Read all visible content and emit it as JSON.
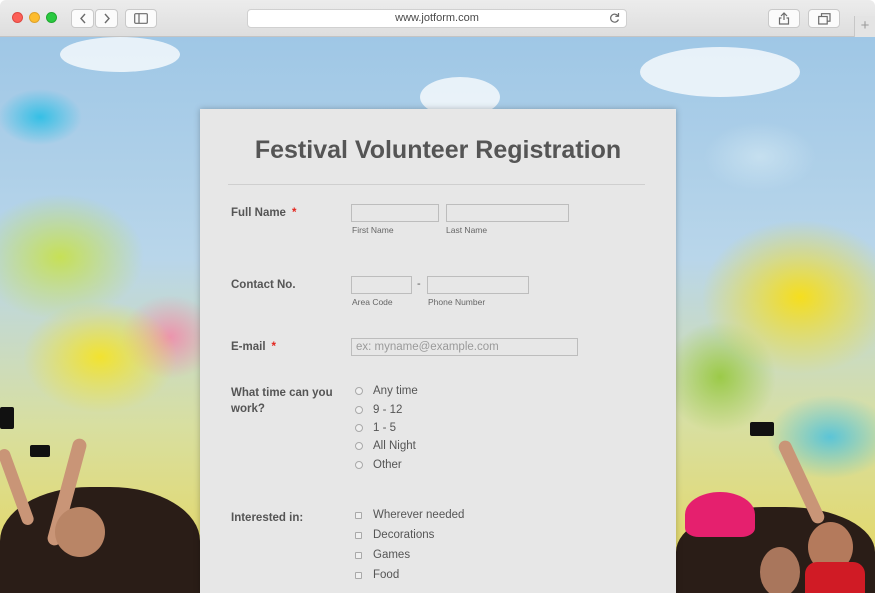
{
  "browser": {
    "url": "www.jotform.com",
    "new_tab": "+"
  },
  "form": {
    "title": "Festival Volunteer Registration",
    "full_name": {
      "label": "Full Name",
      "required_mark": "*",
      "first_value": "",
      "last_value": "",
      "first_sublabel": "First Name",
      "last_sublabel": "Last Name"
    },
    "contact": {
      "label": "Contact No.",
      "separator": "-",
      "area_sublabel": "Area Code",
      "phone_sublabel": "Phone Number"
    },
    "email": {
      "label": "E-mail",
      "required_mark": "*",
      "placeholder": "ex: myname@example.com"
    },
    "time": {
      "label_line1": "What time can you",
      "label_line2": "work?",
      "options": [
        "Any time",
        "9 - 12",
        "1 - 5",
        "All Night",
        "Other"
      ]
    },
    "interests": {
      "label": "Interested in:",
      "options": [
        "Wherever needed",
        "Decorations",
        "Games",
        "Food"
      ]
    }
  },
  "colors": {
    "required": "#e3261e",
    "card": "#e7e7e7",
    "text": "#555555"
  }
}
